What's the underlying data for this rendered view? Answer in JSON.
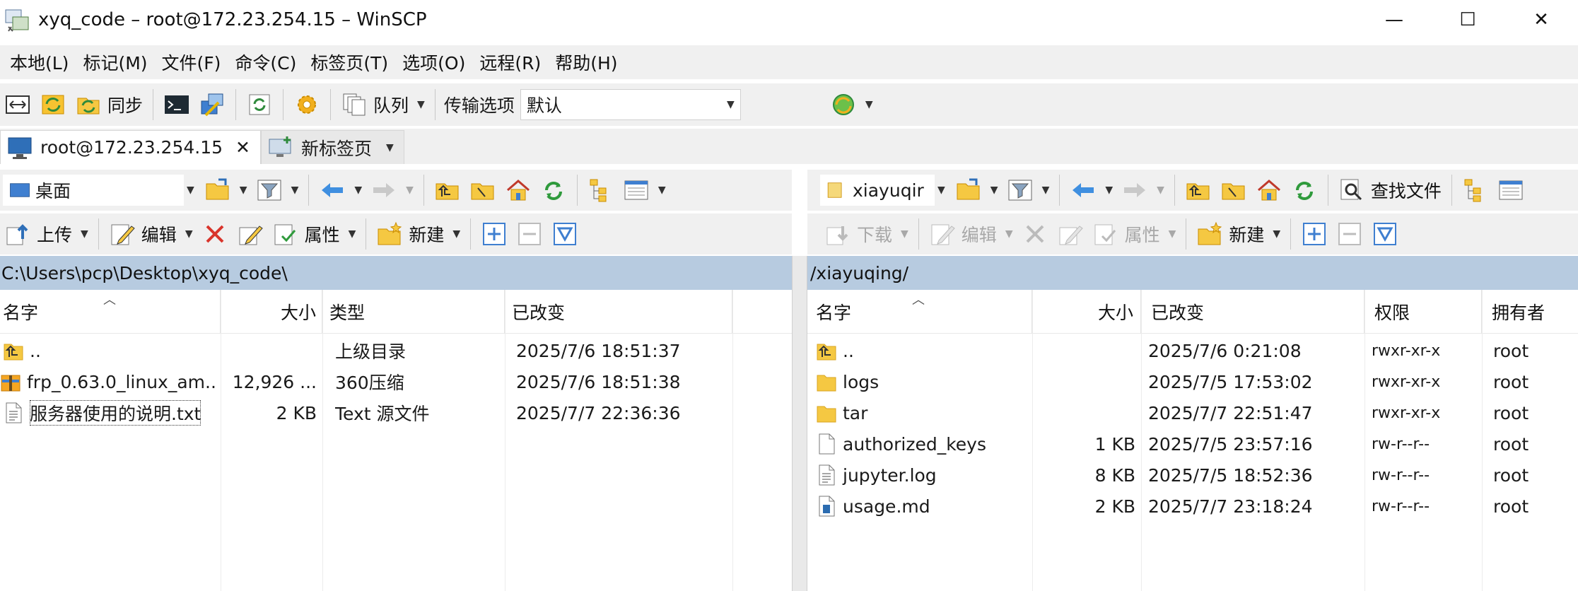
{
  "window": {
    "title": "xyq_code – root@172.23.254.15 – WinSCP",
    "minimize_glyph": "—",
    "maximize_glyph": "☐",
    "close_glyph": "✕"
  },
  "menu": [
    "本地(L)",
    "标记(M)",
    "文件(F)",
    "命令(C)",
    "标签页(T)",
    "选项(O)",
    "远程(R)",
    "帮助(H)"
  ],
  "toolbar": {
    "sync_label": "同步",
    "queue_label": "队列",
    "transfer_label": "传输选项",
    "transfer_value": "默认"
  },
  "tabs": [
    {
      "label": "root@172.23.254.15",
      "close": "✕"
    },
    {
      "label": "新标签页"
    }
  ],
  "left": {
    "location": "桌面",
    "upload_label": "上传",
    "edit_label": "编辑",
    "props_label": "属性",
    "new_label": "新建",
    "path": "C:\\Users\\pcp\\Desktop\\xyq_code\\",
    "columns": [
      "名字",
      "大小",
      "类型",
      "已改变"
    ],
    "files": [
      {
        "name": "..",
        "size": "",
        "type": "上级目录",
        "changed": "2025/7/6 18:51:37",
        "icon": "parent-folder"
      },
      {
        "name": "frp_0.63.0_linux_am...",
        "size": "12,926 ...",
        "type": "360压缩",
        "changed": "2025/7/6 18:51:38",
        "icon": "archive"
      },
      {
        "name": "服务器使用的说明.txt",
        "size": "2 KB",
        "type": "Text 源文件",
        "changed": "2025/7/7 22:36:36",
        "icon": "text-file"
      }
    ]
  },
  "right": {
    "location": "xiayuqir",
    "find_label": "查找文件",
    "download_label": "下载",
    "edit_label": "编辑",
    "props_label": "属性",
    "new_label": "新建",
    "path": "/xiayuqing/",
    "columns": [
      "名字",
      "大小",
      "已改变",
      "权限",
      "拥有者"
    ],
    "files": [
      {
        "name": "..",
        "size": "",
        "changed": "2025/7/6 0:21:08",
        "rights": "rwxr-xr-x",
        "owner": "root",
        "icon": "parent-folder"
      },
      {
        "name": "logs",
        "size": "",
        "changed": "2025/7/5 17:53:02",
        "rights": "rwxr-xr-x",
        "owner": "root",
        "icon": "folder"
      },
      {
        "name": "tar",
        "size": "",
        "changed": "2025/7/7 22:51:47",
        "rights": "rwxr-xr-x",
        "owner": "root",
        "icon": "folder"
      },
      {
        "name": "authorized_keys",
        "size": "1 KB",
        "changed": "2025/7/5 23:57:16",
        "rights": "rw-r--r--",
        "owner": "root",
        "icon": "file"
      },
      {
        "name": "jupyter.log",
        "size": "8 KB",
        "changed": "2025/7/5 18:52:36",
        "rights": "rw-r--r--",
        "owner": "root",
        "icon": "text-file"
      },
      {
        "name": "usage.md",
        "size": "2 KB",
        "changed": "2025/7/7 23:18:24",
        "rights": "rw-r--r--",
        "owner": "root",
        "icon": "markdown-file"
      }
    ]
  },
  "colors": {
    "path_bar": "#b7cbe0",
    "chrome": "#f0f0f0",
    "folder": "#f5c842"
  }
}
